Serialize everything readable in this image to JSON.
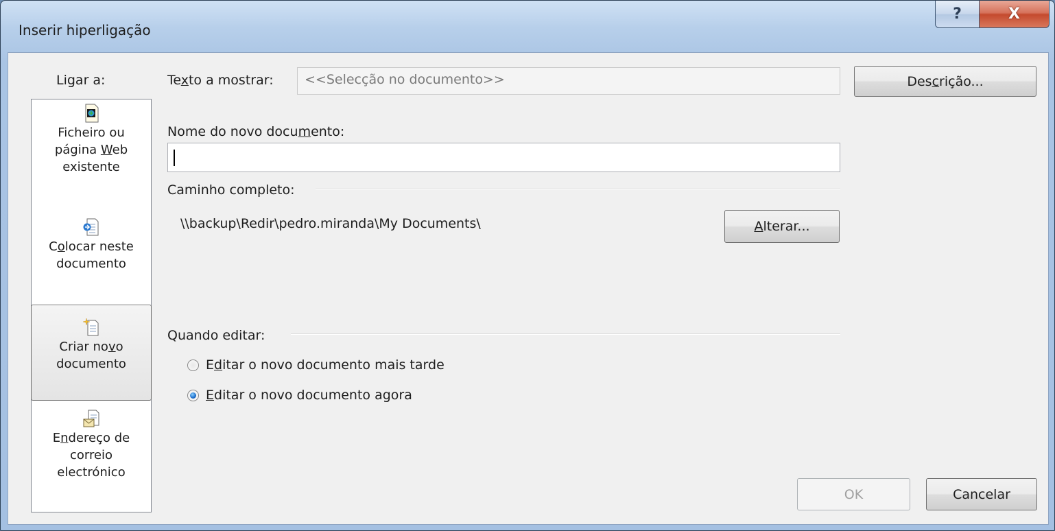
{
  "window": {
    "title": "Inserir hiperligação",
    "help_label": "?",
    "close_label": "X"
  },
  "sidebar": {
    "heading": "Ligar a:",
    "items": [
      {
        "icon": "existing-file-icon",
        "lines": [
          "Ficheiro ou",
          "página Web",
          "existente"
        ]
      },
      {
        "icon": "place-in-document-icon",
        "lines": [
          "Colocar neste",
          "documento"
        ]
      },
      {
        "icon": "new-document-icon",
        "lines": [
          "Criar novo",
          "documento"
        ],
        "selected": true
      },
      {
        "icon": "email-address-icon",
        "lines": [
          "Endereço de",
          "correio",
          "electrónico"
        ]
      }
    ]
  },
  "display_text": {
    "label": "Texto a mostrar:",
    "value": "<<Selecção no documento>>"
  },
  "description_button": "Descrição...",
  "new_doc_name": {
    "label": "Nome do novo documento:",
    "value": ""
  },
  "full_path": {
    "label": "Caminho completo:",
    "value": "\\\\backup\\Redir\\pedro.miranda\\My Documents\\"
  },
  "change_button": "Alterar...",
  "when_edit": {
    "label": "Quando editar:",
    "options": [
      {
        "label": "Editar o novo documento mais tarde",
        "checked": false
      },
      {
        "label": "Editar o novo documento agora",
        "checked": true
      }
    ]
  },
  "ok_button": "OK",
  "cancel_button": "Cancelar"
}
